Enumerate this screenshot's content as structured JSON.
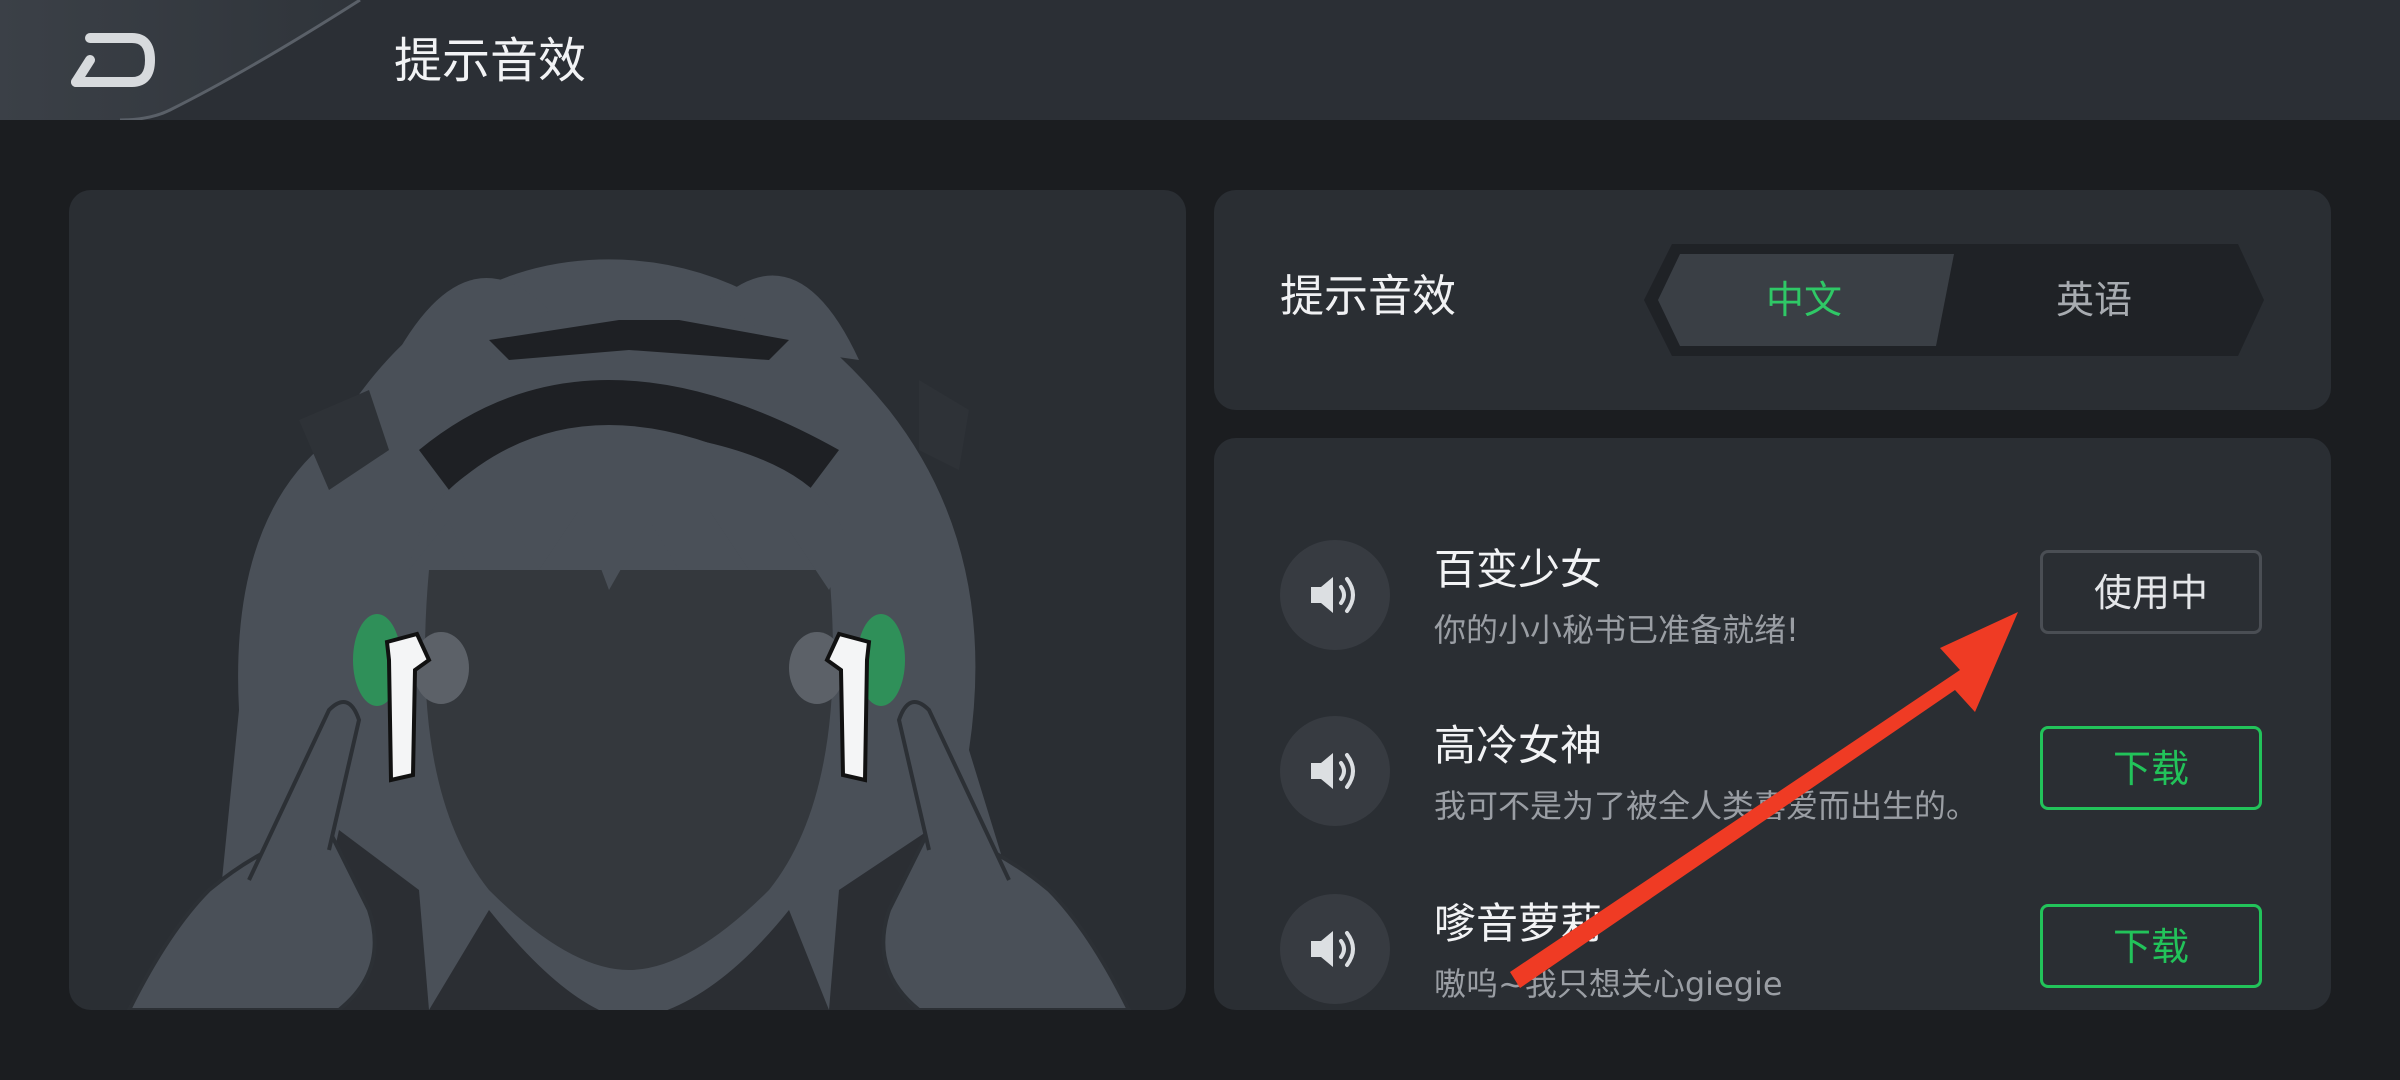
{
  "header": {
    "title": "提示音效"
  },
  "language": {
    "label": "提示音效",
    "options": [
      "中文",
      "英语"
    ],
    "selected": "中文"
  },
  "sounds": [
    {
      "title": "百变少女",
      "subtitle": "你的小小秘书已准备就绪!",
      "action": "使用中"
    },
    {
      "title": "高冷女神",
      "subtitle": "我可不是为了被全人类喜爱而出生的。",
      "action": "下载"
    },
    {
      "title": "嗲音萝莉",
      "subtitle": "嗷呜~我只想关心giegie",
      "action": "下载"
    }
  ],
  "colors": {
    "accent": "#22c35a",
    "background": "#1b1d20",
    "panel": "#2a2e33",
    "annotation_arrow": "#ef3b24"
  },
  "icons": {
    "back": "back-arrow-icon",
    "speaker": "speaker-icon",
    "illustration": "girl-with-earbuds-illustration"
  }
}
